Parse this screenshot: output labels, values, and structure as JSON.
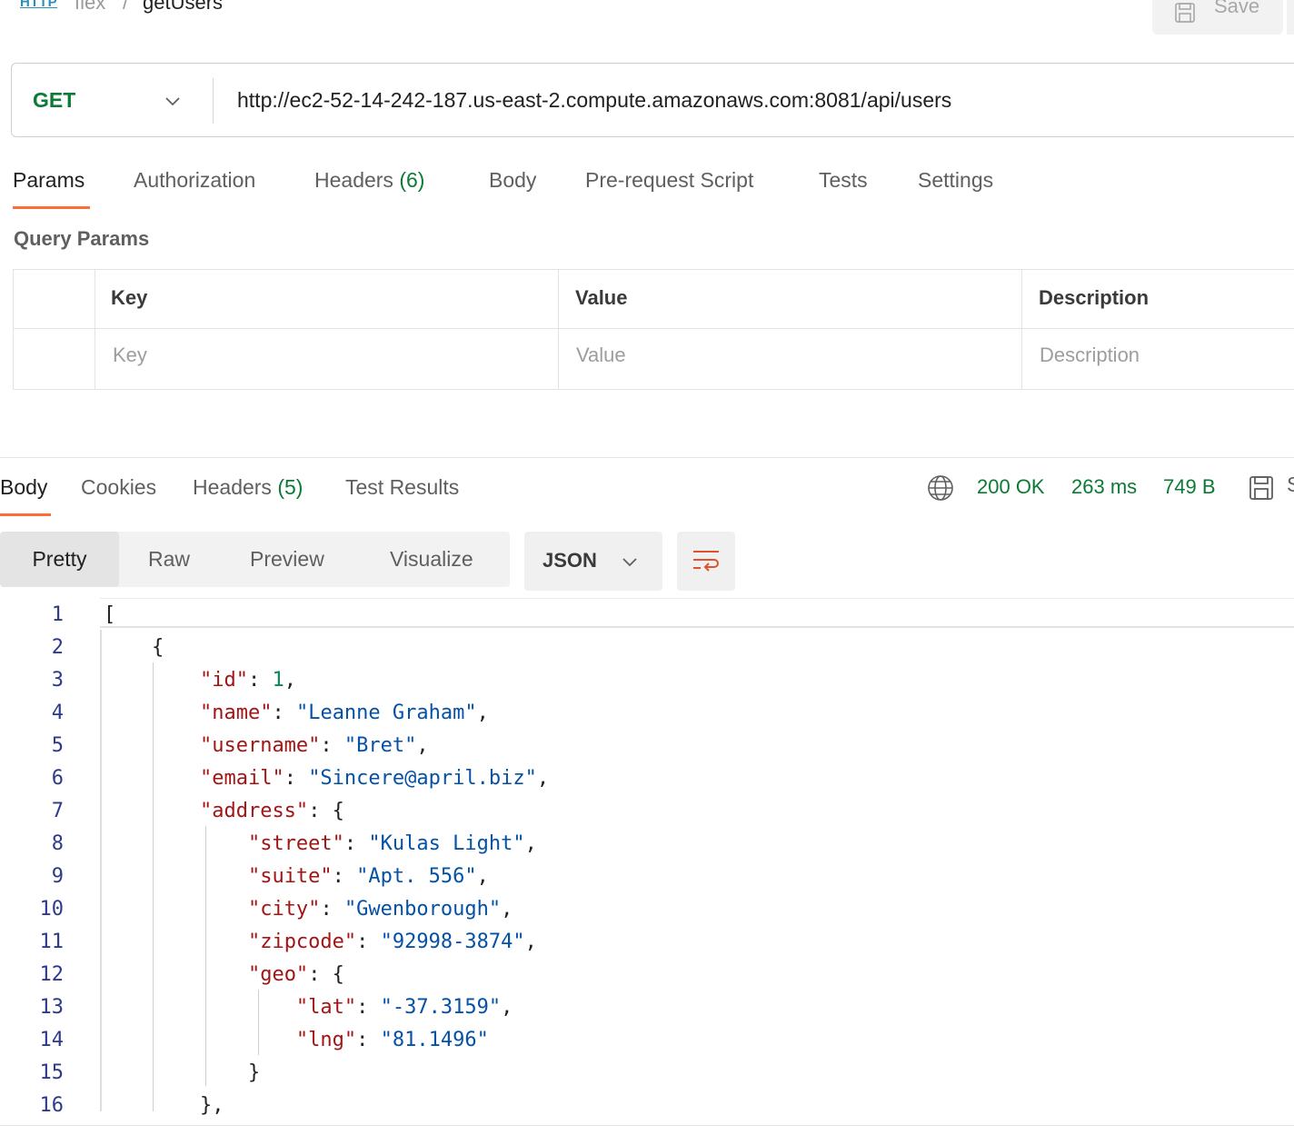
{
  "header": {
    "protocol_icon_label": "HTTP",
    "breadcrumb_parent": "flex",
    "breadcrumb_sep": "/",
    "title": "getUsers",
    "save_label": "Save"
  },
  "request": {
    "method": "GET",
    "url": "http://ec2-52-14-242-187.us-east-2.compute.amazonaws.com:8081/api/users"
  },
  "request_tabs": [
    {
      "label": "Params",
      "count": ""
    },
    {
      "label": "Authorization",
      "count": ""
    },
    {
      "label": "Headers",
      "count": "(6)"
    },
    {
      "label": "Body",
      "count": ""
    },
    {
      "label": "Pre-request Script",
      "count": ""
    },
    {
      "label": "Tests",
      "count": ""
    },
    {
      "label": "Settings",
      "count": ""
    }
  ],
  "query_params": {
    "title": "Query Params",
    "headers": [
      "Key",
      "Value",
      "Description"
    ],
    "placeholders": [
      "Key",
      "Value",
      "Description"
    ]
  },
  "response": {
    "tabs": [
      {
        "label": "Body",
        "count": ""
      },
      {
        "label": "Cookies",
        "count": ""
      },
      {
        "label": "Headers",
        "count": "(5)"
      },
      {
        "label": "Test Results",
        "count": ""
      }
    ],
    "status": "200 OK",
    "time": "263 ms",
    "size": "749 B",
    "save_fragment": "S",
    "views": [
      "Pretty",
      "Raw",
      "Preview",
      "Visualize"
    ],
    "format": "JSON"
  },
  "code": {
    "line_numbers": [
      "1",
      "2",
      "3",
      "4",
      "5",
      "6",
      "7",
      "8",
      "9",
      "10",
      "11",
      "12",
      "13",
      "14",
      "15",
      "16"
    ],
    "lines": [
      "[",
      "    {",
      "        \"id\": 1,",
      "        \"name\": \"Leanne Graham\",",
      "        \"username\": \"Bret\",",
      "        \"email\": \"Sincere@april.biz\",",
      "        \"address\": {",
      "            \"street\": \"Kulas Light\",",
      "            \"suite\": \"Apt. 556\",",
      "            \"city\": \"Gwenborough\",",
      "            \"zipcode\": \"92998-3874\",",
      "            \"geo\": {",
      "                \"lat\": \"-37.3159\",",
      "                \"lng\": \"81.1496\"",
      "            }",
      "        },"
    ]
  },
  "colors": {
    "accent": "#ff6c37",
    "success": "#0b7a35",
    "json_key": "#a31515",
    "json_string": "#0451a5",
    "json_number": "#098658",
    "line_number": "#2d3a8c"
  }
}
